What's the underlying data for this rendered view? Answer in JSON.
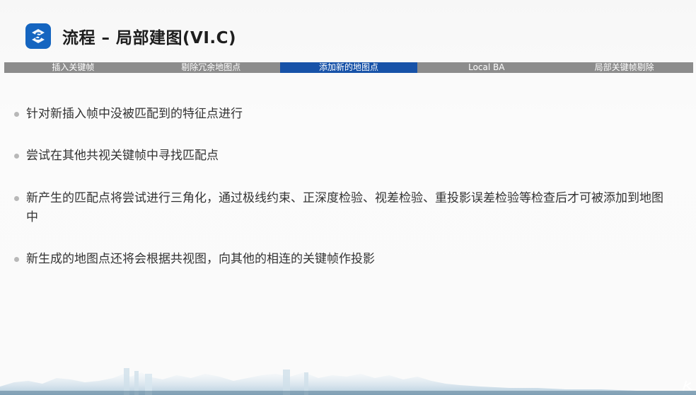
{
  "slide": {
    "title": "流程 – 局部建图(VI.C)",
    "logo_icon": "s-logo-icon",
    "accent_color": "#1752a8"
  },
  "nav": {
    "items": [
      {
        "label": "插入关键帧",
        "active": false
      },
      {
        "label": "剔除冗余地图点",
        "active": false
      },
      {
        "label": "添加新的地图点",
        "active": true
      },
      {
        "label": "Local BA",
        "active": false
      },
      {
        "label": "局部关键帧剔除",
        "active": false
      }
    ]
  },
  "bullets": [
    {
      "text": "针对新插入帧中没被匹配到的特征点进行"
    },
    {
      "text": "尝试在其他共视关键帧中寻找匹配点"
    },
    {
      "text": "新产生的匹配点将尝试进行三角化，通过极线约束、正深度检验、视差检验、重投影误差检验等检查后才可被添加到地图中"
    },
    {
      "text": "新生成的地图点还将会根据共视图，向其他的相连的关键帧作投影"
    }
  ]
}
